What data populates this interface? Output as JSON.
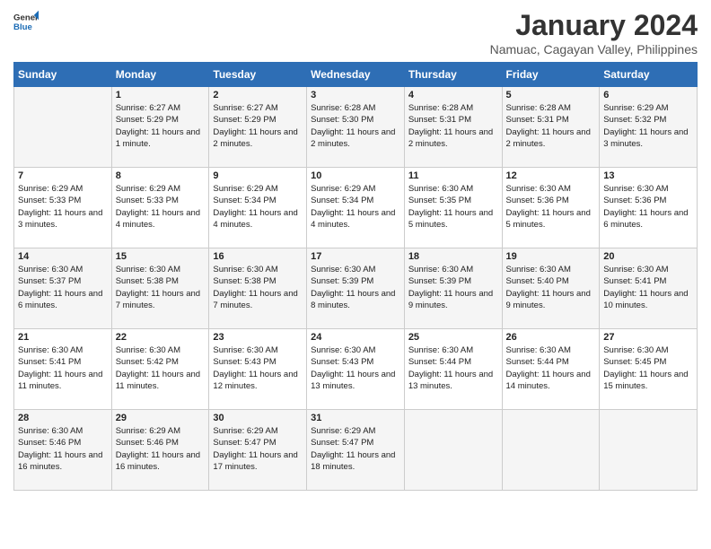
{
  "header": {
    "logo_general": "General",
    "logo_blue": "Blue",
    "month_title": "January 2024",
    "subtitle": "Namuac, Cagayan Valley, Philippines"
  },
  "days_of_week": [
    "Sunday",
    "Monday",
    "Tuesday",
    "Wednesday",
    "Thursday",
    "Friday",
    "Saturday"
  ],
  "weeks": [
    [
      {
        "day": "",
        "sunrise": "",
        "sunset": "",
        "daylight": ""
      },
      {
        "day": "1",
        "sunrise": "Sunrise: 6:27 AM",
        "sunset": "Sunset: 5:29 PM",
        "daylight": "Daylight: 11 hours and 1 minute."
      },
      {
        "day": "2",
        "sunrise": "Sunrise: 6:27 AM",
        "sunset": "Sunset: 5:29 PM",
        "daylight": "Daylight: 11 hours and 2 minutes."
      },
      {
        "day": "3",
        "sunrise": "Sunrise: 6:28 AM",
        "sunset": "Sunset: 5:30 PM",
        "daylight": "Daylight: 11 hours and 2 minutes."
      },
      {
        "day": "4",
        "sunrise": "Sunrise: 6:28 AM",
        "sunset": "Sunset: 5:31 PM",
        "daylight": "Daylight: 11 hours and 2 minutes."
      },
      {
        "day": "5",
        "sunrise": "Sunrise: 6:28 AM",
        "sunset": "Sunset: 5:31 PM",
        "daylight": "Daylight: 11 hours and 2 minutes."
      },
      {
        "day": "6",
        "sunrise": "Sunrise: 6:29 AM",
        "sunset": "Sunset: 5:32 PM",
        "daylight": "Daylight: 11 hours and 3 minutes."
      }
    ],
    [
      {
        "day": "7",
        "sunrise": "Sunrise: 6:29 AM",
        "sunset": "Sunset: 5:33 PM",
        "daylight": "Daylight: 11 hours and 3 minutes."
      },
      {
        "day": "8",
        "sunrise": "Sunrise: 6:29 AM",
        "sunset": "Sunset: 5:33 PM",
        "daylight": "Daylight: 11 hours and 4 minutes."
      },
      {
        "day": "9",
        "sunrise": "Sunrise: 6:29 AM",
        "sunset": "Sunset: 5:34 PM",
        "daylight": "Daylight: 11 hours and 4 minutes."
      },
      {
        "day": "10",
        "sunrise": "Sunrise: 6:29 AM",
        "sunset": "Sunset: 5:34 PM",
        "daylight": "Daylight: 11 hours and 4 minutes."
      },
      {
        "day": "11",
        "sunrise": "Sunrise: 6:30 AM",
        "sunset": "Sunset: 5:35 PM",
        "daylight": "Daylight: 11 hours and 5 minutes."
      },
      {
        "day": "12",
        "sunrise": "Sunrise: 6:30 AM",
        "sunset": "Sunset: 5:36 PM",
        "daylight": "Daylight: 11 hours and 5 minutes."
      },
      {
        "day": "13",
        "sunrise": "Sunrise: 6:30 AM",
        "sunset": "Sunset: 5:36 PM",
        "daylight": "Daylight: 11 hours and 6 minutes."
      }
    ],
    [
      {
        "day": "14",
        "sunrise": "Sunrise: 6:30 AM",
        "sunset": "Sunset: 5:37 PM",
        "daylight": "Daylight: 11 hours and 6 minutes."
      },
      {
        "day": "15",
        "sunrise": "Sunrise: 6:30 AM",
        "sunset": "Sunset: 5:38 PM",
        "daylight": "Daylight: 11 hours and 7 minutes."
      },
      {
        "day": "16",
        "sunrise": "Sunrise: 6:30 AM",
        "sunset": "Sunset: 5:38 PM",
        "daylight": "Daylight: 11 hours and 7 minutes."
      },
      {
        "day": "17",
        "sunrise": "Sunrise: 6:30 AM",
        "sunset": "Sunset: 5:39 PM",
        "daylight": "Daylight: 11 hours and 8 minutes."
      },
      {
        "day": "18",
        "sunrise": "Sunrise: 6:30 AM",
        "sunset": "Sunset: 5:39 PM",
        "daylight": "Daylight: 11 hours and 9 minutes."
      },
      {
        "day": "19",
        "sunrise": "Sunrise: 6:30 AM",
        "sunset": "Sunset: 5:40 PM",
        "daylight": "Daylight: 11 hours and 9 minutes."
      },
      {
        "day": "20",
        "sunrise": "Sunrise: 6:30 AM",
        "sunset": "Sunset: 5:41 PM",
        "daylight": "Daylight: 11 hours and 10 minutes."
      }
    ],
    [
      {
        "day": "21",
        "sunrise": "Sunrise: 6:30 AM",
        "sunset": "Sunset: 5:41 PM",
        "daylight": "Daylight: 11 hours and 11 minutes."
      },
      {
        "day": "22",
        "sunrise": "Sunrise: 6:30 AM",
        "sunset": "Sunset: 5:42 PM",
        "daylight": "Daylight: 11 hours and 11 minutes."
      },
      {
        "day": "23",
        "sunrise": "Sunrise: 6:30 AM",
        "sunset": "Sunset: 5:43 PM",
        "daylight": "Daylight: 11 hours and 12 minutes."
      },
      {
        "day": "24",
        "sunrise": "Sunrise: 6:30 AM",
        "sunset": "Sunset: 5:43 PM",
        "daylight": "Daylight: 11 hours and 13 minutes."
      },
      {
        "day": "25",
        "sunrise": "Sunrise: 6:30 AM",
        "sunset": "Sunset: 5:44 PM",
        "daylight": "Daylight: 11 hours and 13 minutes."
      },
      {
        "day": "26",
        "sunrise": "Sunrise: 6:30 AM",
        "sunset": "Sunset: 5:44 PM",
        "daylight": "Daylight: 11 hours and 14 minutes."
      },
      {
        "day": "27",
        "sunrise": "Sunrise: 6:30 AM",
        "sunset": "Sunset: 5:45 PM",
        "daylight": "Daylight: 11 hours and 15 minutes."
      }
    ],
    [
      {
        "day": "28",
        "sunrise": "Sunrise: 6:30 AM",
        "sunset": "Sunset: 5:46 PM",
        "daylight": "Daylight: 11 hours and 16 minutes."
      },
      {
        "day": "29",
        "sunrise": "Sunrise: 6:29 AM",
        "sunset": "Sunset: 5:46 PM",
        "daylight": "Daylight: 11 hours and 16 minutes."
      },
      {
        "day": "30",
        "sunrise": "Sunrise: 6:29 AM",
        "sunset": "Sunset: 5:47 PM",
        "daylight": "Daylight: 11 hours and 17 minutes."
      },
      {
        "day": "31",
        "sunrise": "Sunrise: 6:29 AM",
        "sunset": "Sunset: 5:47 PM",
        "daylight": "Daylight: 11 hours and 18 minutes."
      },
      {
        "day": "",
        "sunrise": "",
        "sunset": "",
        "daylight": ""
      },
      {
        "day": "",
        "sunrise": "",
        "sunset": "",
        "daylight": ""
      },
      {
        "day": "",
        "sunrise": "",
        "sunset": "",
        "daylight": ""
      }
    ]
  ]
}
